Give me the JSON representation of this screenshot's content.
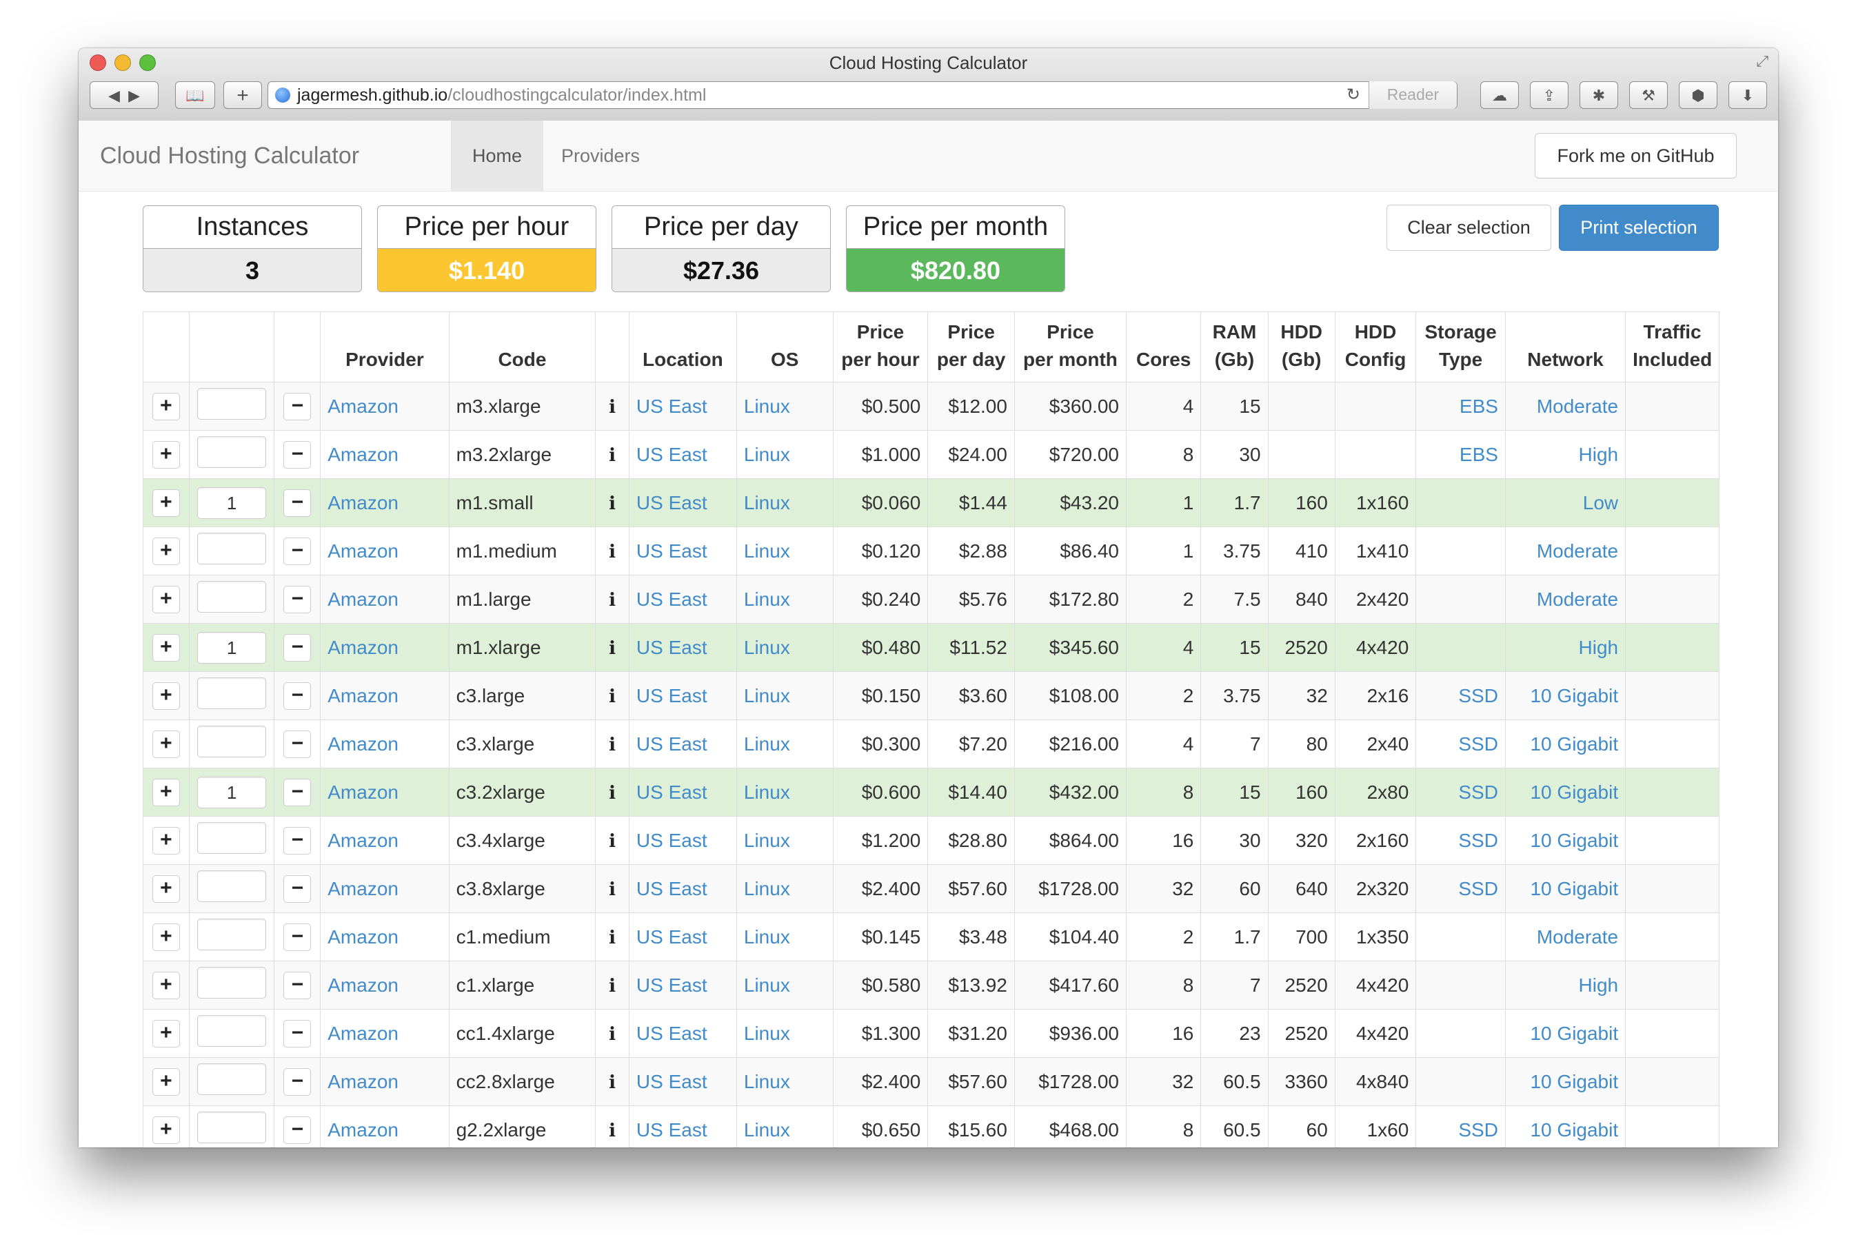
{
  "window": {
    "title": "Cloud Hosting Calculator",
    "url_host": "jagermesh.github.io",
    "url_path": "/cloudhostingcalculator/index.html",
    "reader_label": "Reader"
  },
  "navbar": {
    "brand": "Cloud Hosting Calculator",
    "items": [
      {
        "label": "Home",
        "active": true
      },
      {
        "label": "Providers",
        "active": false
      }
    ],
    "fork_label": "Fork me on GitHub"
  },
  "summary": {
    "instances": {
      "label": "Instances",
      "value": "3"
    },
    "price_hour": {
      "label": "Price per hour",
      "value": "$1.140"
    },
    "price_day": {
      "label": "Price per day",
      "value": "$27.36"
    },
    "price_month": {
      "label": "Price per month",
      "value": "$820.80"
    }
  },
  "actions": {
    "clear_label": "Clear selection",
    "print_label": "Print selection"
  },
  "table": {
    "headers": [
      "",
      "",
      "",
      "Provider",
      "Code",
      "",
      "Location",
      "OS",
      "Price\nper hour",
      "Price\nper day",
      "Price\nper month",
      "Cores",
      "RAM\n(Gb)",
      "HDD\n(Gb)",
      "HDD\nConfig",
      "Storage\nType",
      "Network",
      "Traffic\nIncluded"
    ],
    "plus_glyph": "+",
    "minus_glyph": "−",
    "info_glyph": "i",
    "rows": [
      {
        "qty": "",
        "provider": "Amazon",
        "code": "m3.xlarge",
        "location": "US East",
        "os": "Linux",
        "hour": "$0.500",
        "day": "$12.00",
        "month": "$360.00",
        "cores": "4",
        "ram": "15",
        "hdd": "",
        "hdd_config": "",
        "storage": "EBS",
        "network": "Moderate",
        "traffic": ""
      },
      {
        "qty": "",
        "provider": "Amazon",
        "code": "m3.2xlarge",
        "location": "US East",
        "os": "Linux",
        "hour": "$1.000",
        "day": "$24.00",
        "month": "$720.00",
        "cores": "8",
        "ram": "30",
        "hdd": "",
        "hdd_config": "",
        "storage": "EBS",
        "network": "High",
        "traffic": ""
      },
      {
        "qty": "1",
        "provider": "Amazon",
        "code": "m1.small",
        "location": "US East",
        "os": "Linux",
        "hour": "$0.060",
        "day": "$1.44",
        "month": "$43.20",
        "cores": "1",
        "ram": "1.7",
        "hdd": "160",
        "hdd_config": "1x160",
        "storage": "",
        "network": "Low",
        "traffic": ""
      },
      {
        "qty": "",
        "provider": "Amazon",
        "code": "m1.medium",
        "location": "US East",
        "os": "Linux",
        "hour": "$0.120",
        "day": "$2.88",
        "month": "$86.40",
        "cores": "1",
        "ram": "3.75",
        "hdd": "410",
        "hdd_config": "1x410",
        "storage": "",
        "network": "Moderate",
        "traffic": ""
      },
      {
        "qty": "",
        "provider": "Amazon",
        "code": "m1.large",
        "location": "US East",
        "os": "Linux",
        "hour": "$0.240",
        "day": "$5.76",
        "month": "$172.80",
        "cores": "2",
        "ram": "7.5",
        "hdd": "840",
        "hdd_config": "2x420",
        "storage": "",
        "network": "Moderate",
        "traffic": ""
      },
      {
        "qty": "1",
        "provider": "Amazon",
        "code": "m1.xlarge",
        "location": "US East",
        "os": "Linux",
        "hour": "$0.480",
        "day": "$11.52",
        "month": "$345.60",
        "cores": "4",
        "ram": "15",
        "hdd": "2520",
        "hdd_config": "4x420",
        "storage": "",
        "network": "High",
        "traffic": ""
      },
      {
        "qty": "",
        "provider": "Amazon",
        "code": "c3.large",
        "location": "US East",
        "os": "Linux",
        "hour": "$0.150",
        "day": "$3.60",
        "month": "$108.00",
        "cores": "2",
        "ram": "3.75",
        "hdd": "32",
        "hdd_config": "2x16",
        "storage": "SSD",
        "network": "10 Gigabit",
        "traffic": ""
      },
      {
        "qty": "",
        "provider": "Amazon",
        "code": "c3.xlarge",
        "location": "US East",
        "os": "Linux",
        "hour": "$0.300",
        "day": "$7.20",
        "month": "$216.00",
        "cores": "4",
        "ram": "7",
        "hdd": "80",
        "hdd_config": "2x40",
        "storage": "SSD",
        "network": "10 Gigabit",
        "traffic": ""
      },
      {
        "qty": "1",
        "provider": "Amazon",
        "code": "c3.2xlarge",
        "location": "US East",
        "os": "Linux",
        "hour": "$0.600",
        "day": "$14.40",
        "month": "$432.00",
        "cores": "8",
        "ram": "15",
        "hdd": "160",
        "hdd_config": "2x80",
        "storage": "SSD",
        "network": "10 Gigabit",
        "traffic": ""
      },
      {
        "qty": "",
        "provider": "Amazon",
        "code": "c3.4xlarge",
        "location": "US East",
        "os": "Linux",
        "hour": "$1.200",
        "day": "$28.80",
        "month": "$864.00",
        "cores": "16",
        "ram": "30",
        "hdd": "320",
        "hdd_config": "2x160",
        "storage": "SSD",
        "network": "10 Gigabit",
        "traffic": ""
      },
      {
        "qty": "",
        "provider": "Amazon",
        "code": "c3.8xlarge",
        "location": "US East",
        "os": "Linux",
        "hour": "$2.400",
        "day": "$57.60",
        "month": "$1728.00",
        "cores": "32",
        "ram": "60",
        "hdd": "640",
        "hdd_config": "2x320",
        "storage": "SSD",
        "network": "10 Gigabit",
        "traffic": ""
      },
      {
        "qty": "",
        "provider": "Amazon",
        "code": "c1.medium",
        "location": "US East",
        "os": "Linux",
        "hour": "$0.145",
        "day": "$3.48",
        "month": "$104.40",
        "cores": "2",
        "ram": "1.7",
        "hdd": "700",
        "hdd_config": "1x350",
        "storage": "",
        "network": "Moderate",
        "traffic": ""
      },
      {
        "qty": "",
        "provider": "Amazon",
        "code": "c1.xlarge",
        "location": "US East",
        "os": "Linux",
        "hour": "$0.580",
        "day": "$13.92",
        "month": "$417.60",
        "cores": "8",
        "ram": "7",
        "hdd": "2520",
        "hdd_config": "4x420",
        "storage": "",
        "network": "High",
        "traffic": ""
      },
      {
        "qty": "",
        "provider": "Amazon",
        "code": "cc1.4xlarge",
        "location": "US East",
        "os": "Linux",
        "hour": "$1.300",
        "day": "$31.20",
        "month": "$936.00",
        "cores": "16",
        "ram": "23",
        "hdd": "2520",
        "hdd_config": "4x420",
        "storage": "",
        "network": "10 Gigabit",
        "traffic": ""
      },
      {
        "qty": "",
        "provider": "Amazon",
        "code": "cc2.8xlarge",
        "location": "US East",
        "os": "Linux",
        "hour": "$2.400",
        "day": "$57.60",
        "month": "$1728.00",
        "cores": "32",
        "ram": "60.5",
        "hdd": "3360",
        "hdd_config": "4x840",
        "storage": "",
        "network": "10 Gigabit",
        "traffic": ""
      },
      {
        "qty": "",
        "provider": "Amazon",
        "code": "g2.2xlarge",
        "location": "US East",
        "os": "Linux",
        "hour": "$0.650",
        "day": "$15.60",
        "month": "$468.00",
        "cores": "8",
        "ram": "60.5",
        "hdd": "60",
        "hdd_config": "1x60",
        "storage": "SSD",
        "network": "10 Gigabit",
        "traffic": ""
      }
    ]
  },
  "colors": {
    "link": "#428bca",
    "selected_row": "#dff0d8",
    "hour_box": "#fcc631",
    "month_box": "#5cb85c",
    "print_button": "#428bca"
  },
  "icons": {
    "back": "back-arrow-icon",
    "forward": "forward-arrow-icon",
    "bookmarks": "bookmarks-book-icon",
    "new_tab": "plus-icon",
    "site": "globe-icon",
    "reload": "reload-icon",
    "icloud": "cloud-icon",
    "share": "share-icon",
    "extensions": "puzzle-icon",
    "settings": "wrench-icon",
    "adblock": "shield-icon",
    "downloads": "download-icon"
  }
}
